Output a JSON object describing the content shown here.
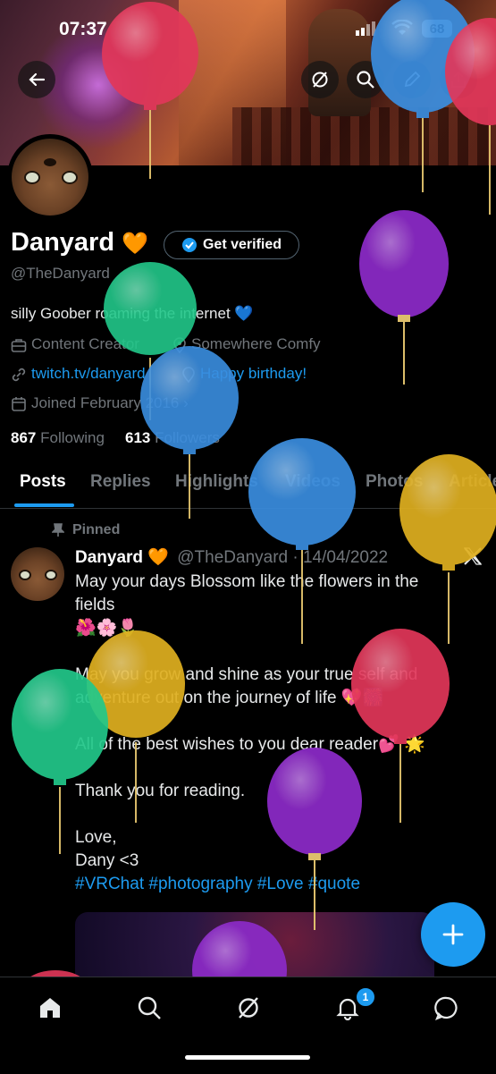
{
  "status_bar": {
    "time": "07:37",
    "battery": "68"
  },
  "profile": {
    "name": "Danyard",
    "name_emoji": "🧡",
    "verify_label": "Get verified",
    "handle": "@TheDanyard",
    "bio": "silly Goober roaming the internet 💙",
    "category": "Content Creator",
    "location": "Somewhere Comfy",
    "website": "twitch.tv/danyard",
    "birthday": "Happy birthday!",
    "joined": "Joined February 2016",
    "following_count": "867",
    "following_label": "Following",
    "followers_count": "613",
    "followers_label": "Followers"
  },
  "tabs": [
    "Posts",
    "Replies",
    "Highlights",
    "Videos",
    "Photos",
    "Articles"
  ],
  "pinned_post": {
    "pinned_label": "Pinned",
    "author": "Danyard",
    "author_emoji": "🧡",
    "handle_date": "@TheDanyard · 14/04/2022",
    "lines": [
      "May your days Blossom like the flowers in the",
      "fields",
      "🌺🌸🌷",
      "",
      "May you grow and shine as your true self and",
      "adventure out on the journey of life 💖🎆",
      "",
      "All of the best wishes to you dear reader💕 🌟",
      "",
      "Thank you for reading.",
      "",
      "Love,",
      " Dany <3"
    ],
    "hashtags": "#VRChat #photography #Love #quote"
  },
  "bottom_nav": {
    "notifications_badge": "1"
  },
  "icons": [
    "back-arrow-icon",
    "grok-icon",
    "search-icon",
    "edit-icon",
    "share-icon",
    "verified-icon",
    "briefcase-icon",
    "link-icon",
    "location-icon",
    "calendar-icon",
    "pin-icon",
    "x-logo-icon",
    "plus-icon",
    "home-icon",
    "bell-icon",
    "chat-icon"
  ],
  "colors": {
    "accent": "#1d9bf0",
    "muted": "#71767b",
    "background": "#000000"
  }
}
